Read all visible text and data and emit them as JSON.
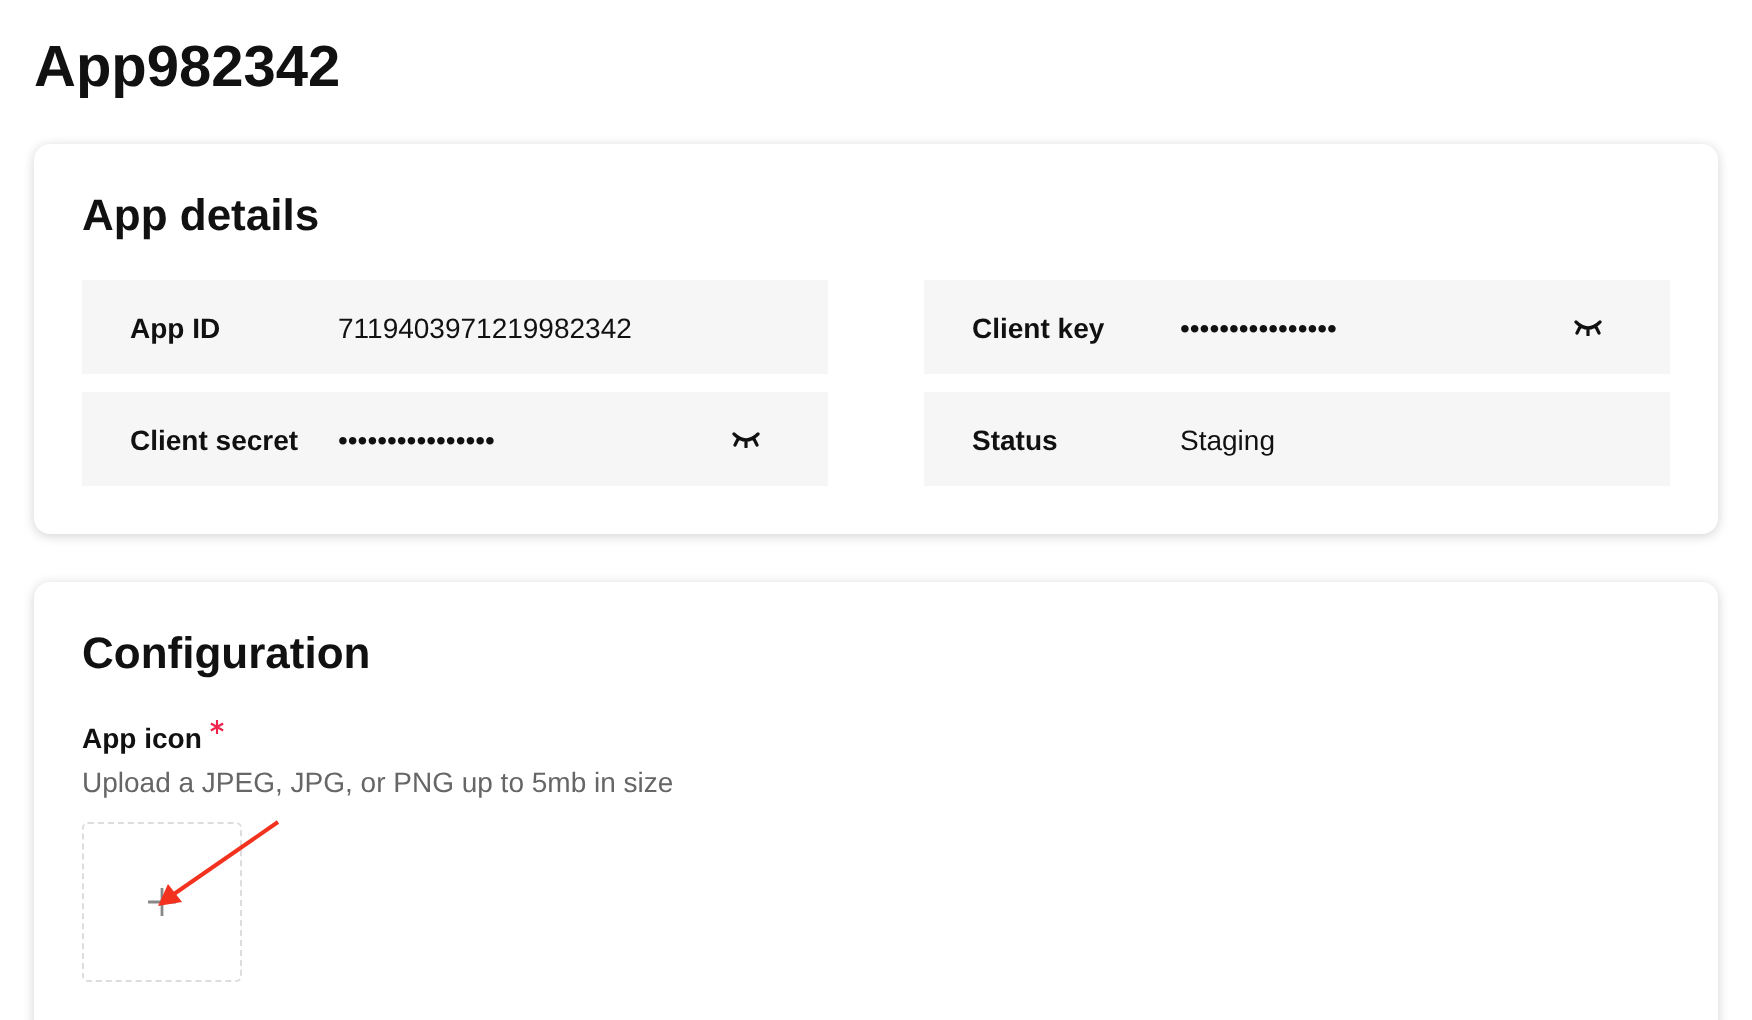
{
  "page": {
    "title": "App982342"
  },
  "app_details": {
    "title": "App details",
    "fields": [
      {
        "label": "App ID",
        "value": "7119403971219982342",
        "masked": false
      },
      {
        "label": "Client key",
        "value": "••••••••••••••••",
        "masked": true
      },
      {
        "label": "Client secret",
        "value": "••••••••••••••••",
        "masked": true
      },
      {
        "label": "Status",
        "value": "Staging",
        "masked": false
      }
    ]
  },
  "configuration": {
    "title": "Configuration",
    "app_icon": {
      "label": "App icon",
      "required": true,
      "hint": "Upload a JPEG, JPG, or PNG up to 5mb in size"
    }
  }
}
